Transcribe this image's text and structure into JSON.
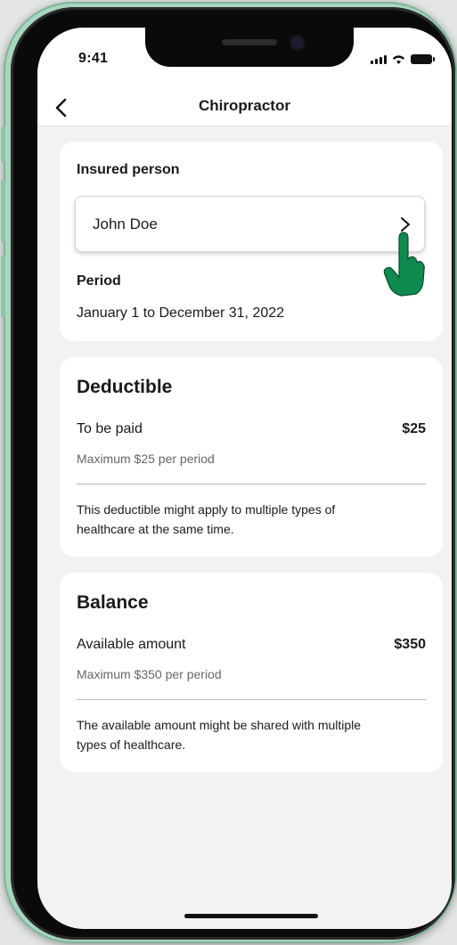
{
  "status_bar": {
    "time": "9:41"
  },
  "nav": {
    "title": "Chiropractor",
    "back_icon": "chevron-left-icon"
  },
  "insured_card": {
    "insured_label": "Insured person",
    "insured_value": "John Doe",
    "select_icon": "chevron-right-icon",
    "period_label": "Period",
    "period_value": "January 1 to December 31, 2022"
  },
  "deductible_card": {
    "title": "Deductible",
    "row_label": "To be paid",
    "row_value": "$25",
    "row_sub": "Maximum $25 per period",
    "note_line1": "This deductible might apply to multiple types of",
    "note_line2": "healthcare at the same time."
  },
  "balance_card": {
    "title": "Balance",
    "row_label": "Available amount",
    "row_value": "$350",
    "row_sub": "Maximum $350 per period",
    "note_line1": "The available amount might be shared with multiple",
    "note_line2": "types of healthcare."
  },
  "colors": {
    "accent_hand": "#0e8a4f",
    "phone_frame": "#a8d6bf",
    "screen_bg": "#f2f2f2"
  }
}
